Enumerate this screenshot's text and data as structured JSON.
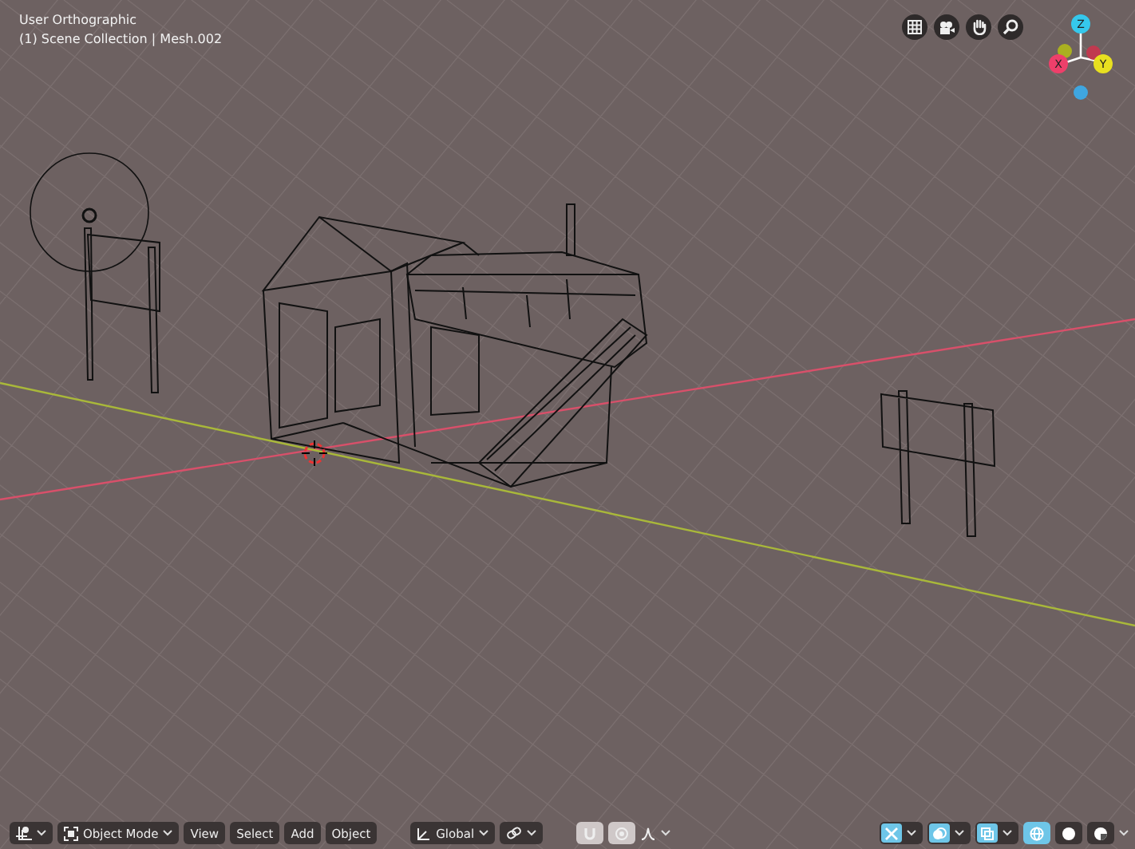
{
  "header": {
    "view_name": "User Orthographic",
    "collection": "(1) Scene Collection | Mesh.002"
  },
  "nav_buttons": [
    {
      "kind": "grid"
    },
    {
      "kind": "camera"
    },
    {
      "kind": "hand"
    },
    {
      "kind": "zoom"
    }
  ],
  "axis_gizmo": {
    "labels": [
      "Z",
      "X",
      "Y"
    ]
  },
  "bottom_bar": {
    "mode": "Object Mode",
    "menus": [
      "View",
      "Select",
      "Add",
      "Object"
    ],
    "orientation": "Global",
    "toggles": [
      {
        "kind": "snap",
        "on": false
      },
      {
        "kind": "proportional",
        "on": false
      },
      {
        "kind": "gizmo",
        "on": true
      },
      {
        "kind": "overlay",
        "on": true
      },
      {
        "kind": "xray",
        "on": true
      }
    ],
    "shading": [
      {
        "kind": "wireframe",
        "selected": true
      },
      {
        "kind": "solid",
        "selected": false
      },
      {
        "kind": "material",
        "selected": false
      }
    ]
  }
}
